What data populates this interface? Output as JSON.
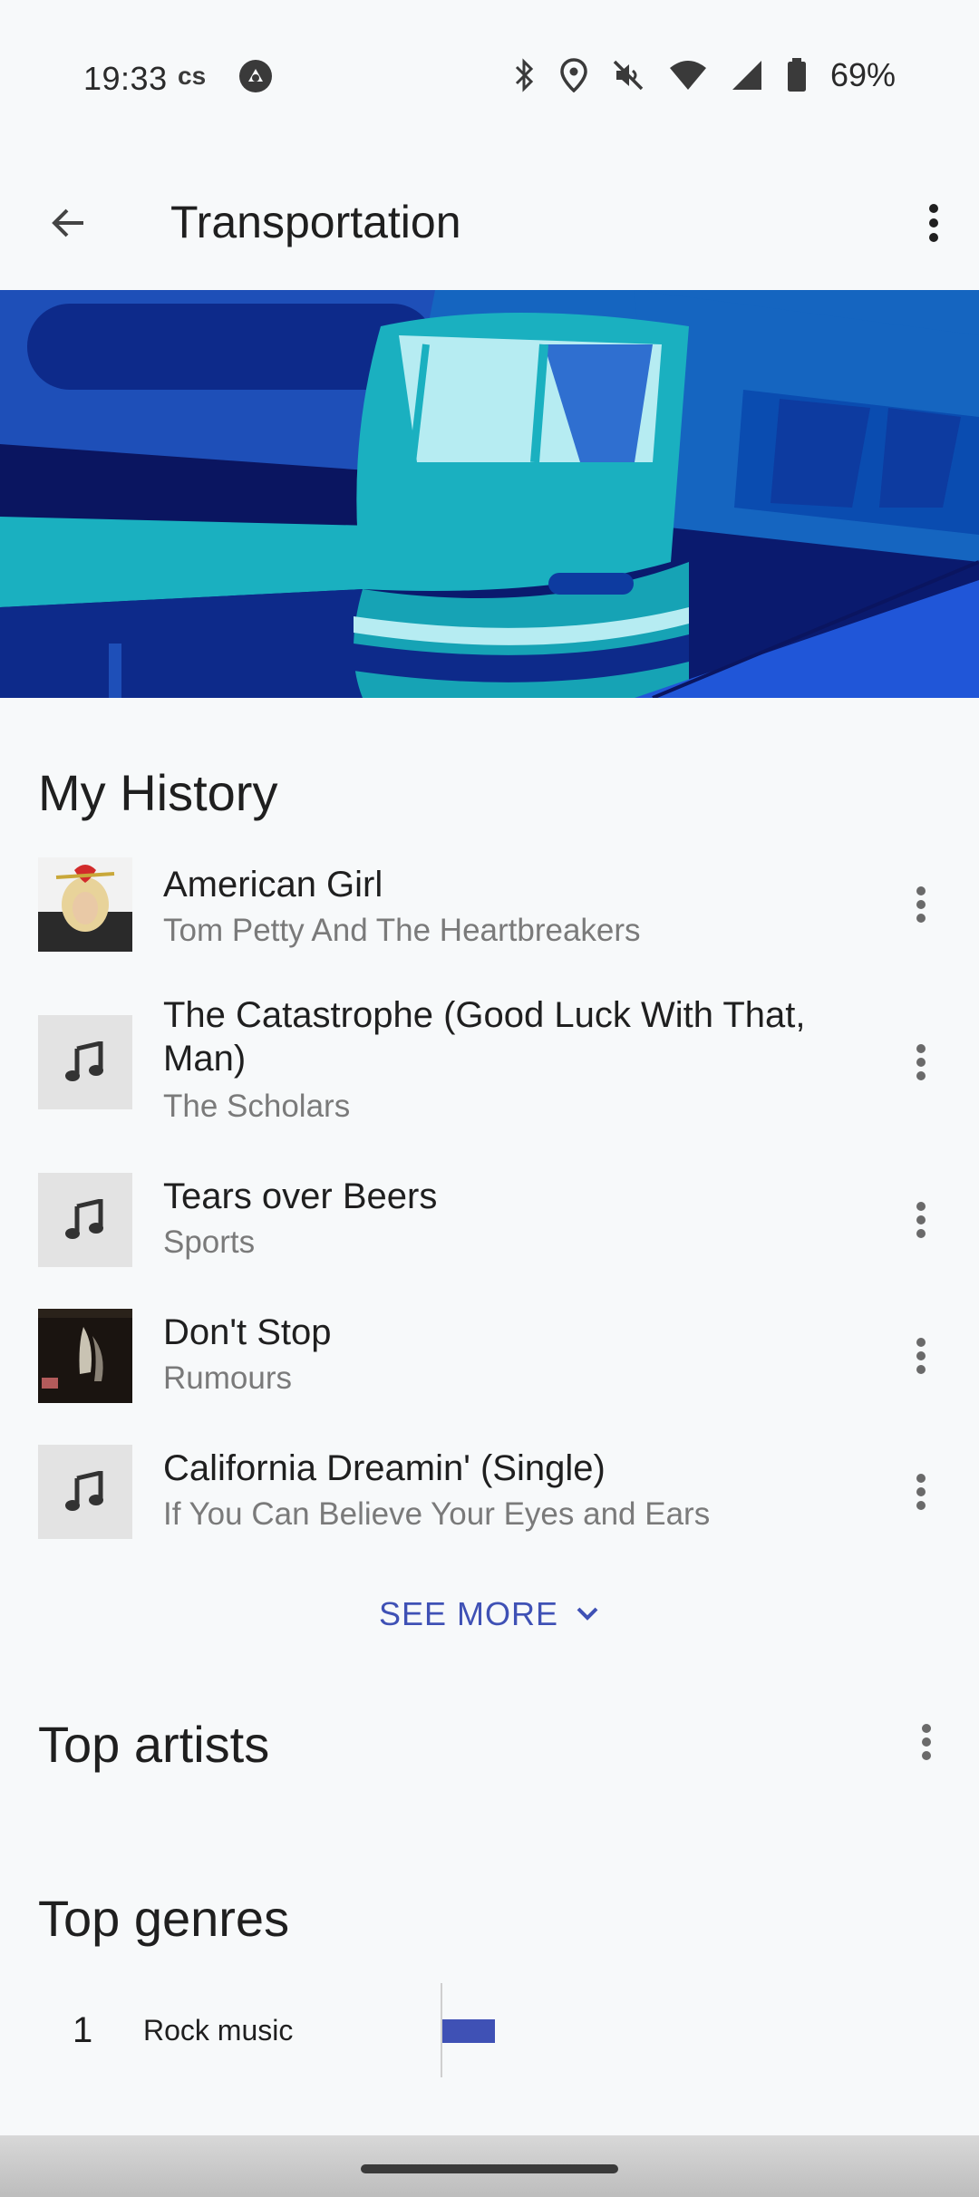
{
  "status_bar": {
    "time": "19:33",
    "left_icons": [
      "lastfm-icon",
      "assistant-icon"
    ],
    "right_icons": [
      "bluetooth-icon",
      "location-icon",
      "mute-icon",
      "wifi-icon",
      "cell-signal-icon",
      "battery-icon"
    ],
    "battery_percent": "69%"
  },
  "app_bar": {
    "title": "Transportation",
    "back_icon": "arrow-back-icon",
    "menu_icon": "more-vert-icon"
  },
  "hero": {
    "image": "transportation-train-illustration"
  },
  "history": {
    "title": "My History",
    "items": [
      {
        "title": "American Girl",
        "artist": "Tom Petty And The Heartbreakers",
        "art": "album-art-american-girl"
      },
      {
        "title": "The Catastrophe (Good Luck With That, Man)",
        "artist": "The Scholars",
        "art": "music-note-icon"
      },
      {
        "title": "Tears over Beers",
        "artist": "Sports",
        "art": "music-note-icon"
      },
      {
        "title": "Don't Stop",
        "artist": "Rumours",
        "art": "album-art-rumours"
      },
      {
        "title": "California Dreamin' (Single)",
        "artist": "If You Can Believe Your Eyes and Ears",
        "art": "music-note-icon"
      }
    ],
    "see_more": "SEE MORE"
  },
  "top_artists": {
    "title": "Top artists"
  },
  "top_genres": {
    "title": "Top genres",
    "items": [
      {
        "rank": "1",
        "name": "Rock music",
        "share": 0.2
      }
    ]
  },
  "colors": {
    "accent": "#3f51b5",
    "background": "#f7f9fa",
    "secondary_text": "#7a7a7a"
  }
}
